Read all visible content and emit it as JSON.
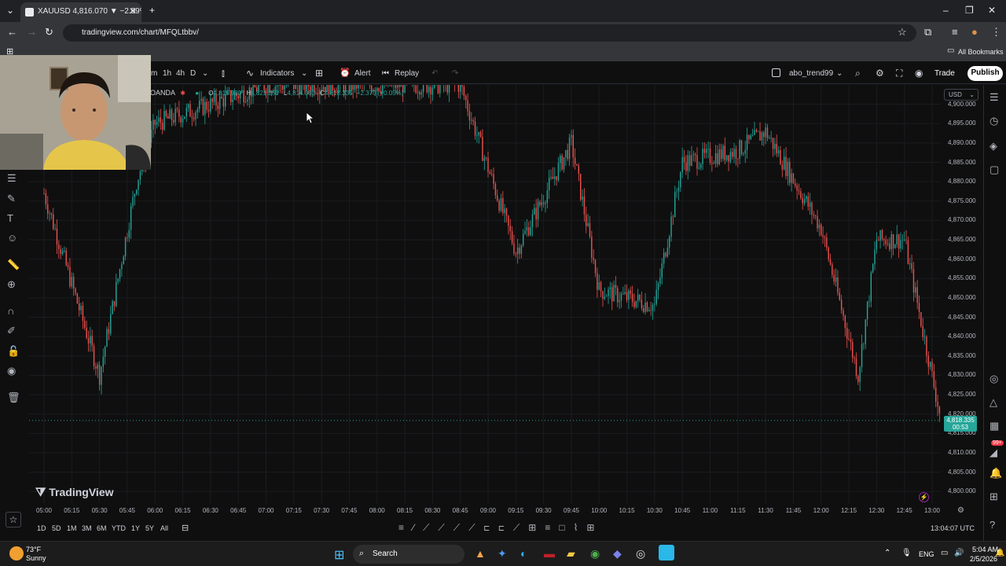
{
  "browser": {
    "tab_title": "XAUUSD 4,816.070 ▼ −2.99% u",
    "url": "tradingview.com/chart/MFQLtbbv/",
    "bookmarks_label": "All Bookmarks"
  },
  "toolbar": {
    "intervals": [
      "m",
      "1h",
      "4h",
      "D"
    ],
    "indicators": "Indicators",
    "alert": "Alert",
    "replay": "Replay",
    "layout_name": "abo_trend99",
    "trade": "Trade",
    "publish": "Publish"
  },
  "legend": {
    "broker": "OANDA",
    "open_label": "O",
    "open": "4,815.980",
    "high_label": "H",
    "high": "4,821.250",
    "low_label": "L",
    "low": "4,814.080",
    "close_label": "C",
    "close": "4,818.335",
    "change": "+2.370 (+0.05%)"
  },
  "currency": "USD",
  "last_price": {
    "price": "4,818.335",
    "countdown": "00:53"
  },
  "brand": "TradingView",
  "range_buttons": [
    "1D",
    "5D",
    "1M",
    "3M",
    "6M",
    "YTD",
    "1Y",
    "5Y",
    "All"
  ],
  "clock_utc": "13:04:07 UTC",
  "notification_count": "99+",
  "taskbar": {
    "temp": "73°F",
    "weather": "Sunny",
    "search": "Search",
    "lang": "ENG",
    "time": "5:04 AM",
    "date": "2/5/2026"
  },
  "chart_data": {
    "type": "candlestick",
    "symbol": "XAUUSD",
    "price_ticks": [
      "4,900.000",
      "4,895.000",
      "4,890.000",
      "4,885.000",
      "4,880.000",
      "4,875.000",
      "4,870.000",
      "4,865.000",
      "4,860.000",
      "4,855.000",
      "4,850.000",
      "4,845.000",
      "4,840.000",
      "4,835.000",
      "4,830.000",
      "4,825.000",
      "4,820.000",
      "4,815.000",
      "4,810.000",
      "4,805.000",
      "4,800.000"
    ],
    "time_ticks": [
      "05:00",
      "05:15",
      "05:30",
      "05:45",
      "06:00",
      "06:15",
      "06:30",
      "06:45",
      "07:00",
      "07:15",
      "07:30",
      "07:45",
      "08:00",
      "08:15",
      "08:30",
      "08:45",
      "09:00",
      "09:15",
      "09:30",
      "09:45",
      "10:00",
      "10:15",
      "10:30",
      "10:45",
      "11:00",
      "11:15",
      "11:30",
      "11:45",
      "12:00",
      "12:15",
      "12:30",
      "12:45",
      "13:00"
    ],
    "ylim": [
      4797,
      4905
    ],
    "colors": {
      "up": "#26a69a",
      "down": "#ef5350"
    },
    "key_points": [
      {
        "time": "05:00",
        "price": 4877
      },
      {
        "time": "05:30",
        "price": 4830
      },
      {
        "time": "05:50",
        "price": 4880
      },
      {
        "time": "06:00",
        "price": 4895
      },
      {
        "time": "07:00",
        "price": 4905
      },
      {
        "time": "08:45",
        "price": 4905
      },
      {
        "time": "09:15",
        "price": 4862
      },
      {
        "time": "09:45",
        "price": 4890
      },
      {
        "time": "10:00",
        "price": 4852
      },
      {
        "time": "10:30",
        "price": 4848
      },
      {
        "time": "10:45",
        "price": 4885
      },
      {
        "time": "11:15",
        "price": 4888
      },
      {
        "time": "11:30",
        "price": 4893
      },
      {
        "time": "12:00",
        "price": 4868
      },
      {
        "time": "12:20",
        "price": 4830
      },
      {
        "time": "12:30",
        "price": 4865
      },
      {
        "time": "12:45",
        "price": 4865
      },
      {
        "time": "13:05",
        "price": 4818
      }
    ]
  }
}
